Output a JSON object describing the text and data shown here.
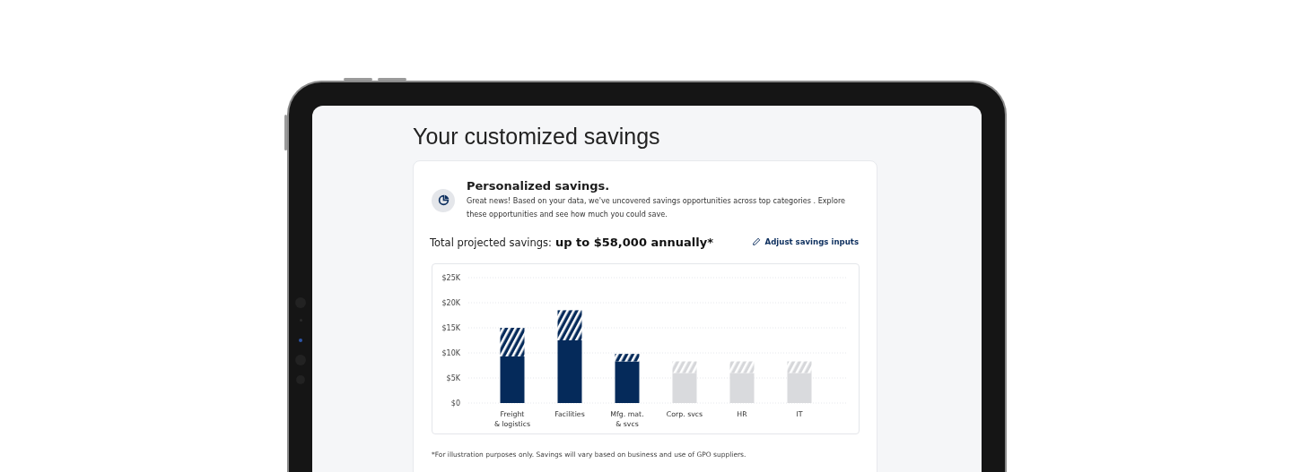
{
  "page": {
    "title": "Your customized savings"
  },
  "summary": {
    "title": "Personalized savings.",
    "text": "Great news! Based on your data, we've uncovered savings opportunities across top categories . Explore these opportunities and see how much you could save."
  },
  "total": {
    "label": "Total projected savings:",
    "value": "up to $58,000 annually*",
    "action": "Adjust savings inputs"
  },
  "chart": {
    "chart_data": {
      "type": "bar",
      "stacked": true,
      "categories": [
        "Freight\n& logistics",
        "Facilities",
        "Mfg. mat.\n& svcs",
        "Corp. svcs",
        "HR",
        "IT"
      ],
      "series": [
        {
          "colors": [
            "#052a5a",
            "#052a5a",
            "#052a5a",
            "#d9dadd",
            "#d9dadd",
            "#d9dadd"
          ],
          "values": [
            9300,
            12500,
            8300,
            6000,
            6000,
            6000
          ]
        },
        {
          "colors": [
            "#052a5a",
            "#052a5a",
            "#052a5a",
            "#d6d7da",
            "#d6d7da",
            "#d6d7da"
          ],
          "values": [
            5700,
            6000,
            1500,
            2300,
            2300,
            2300
          ]
        }
      ],
      "grid": true,
      "ylim": [
        0,
        25000
      ],
      "yticks": [
        {
          "value": 0,
          "label": "$0"
        },
        {
          "value": 5000,
          "label": "$5K"
        },
        {
          "value": 10000,
          "label": "$10K"
        },
        {
          "value": 15000,
          "label": "$15K"
        },
        {
          "value": 20000,
          "label": "$20K"
        },
        {
          "value": 25000,
          "label": "$25K"
        }
      ]
    }
  },
  "footnote": "*For illustration purposes only. Savings will vary based on business and use of GPO suppliers."
}
